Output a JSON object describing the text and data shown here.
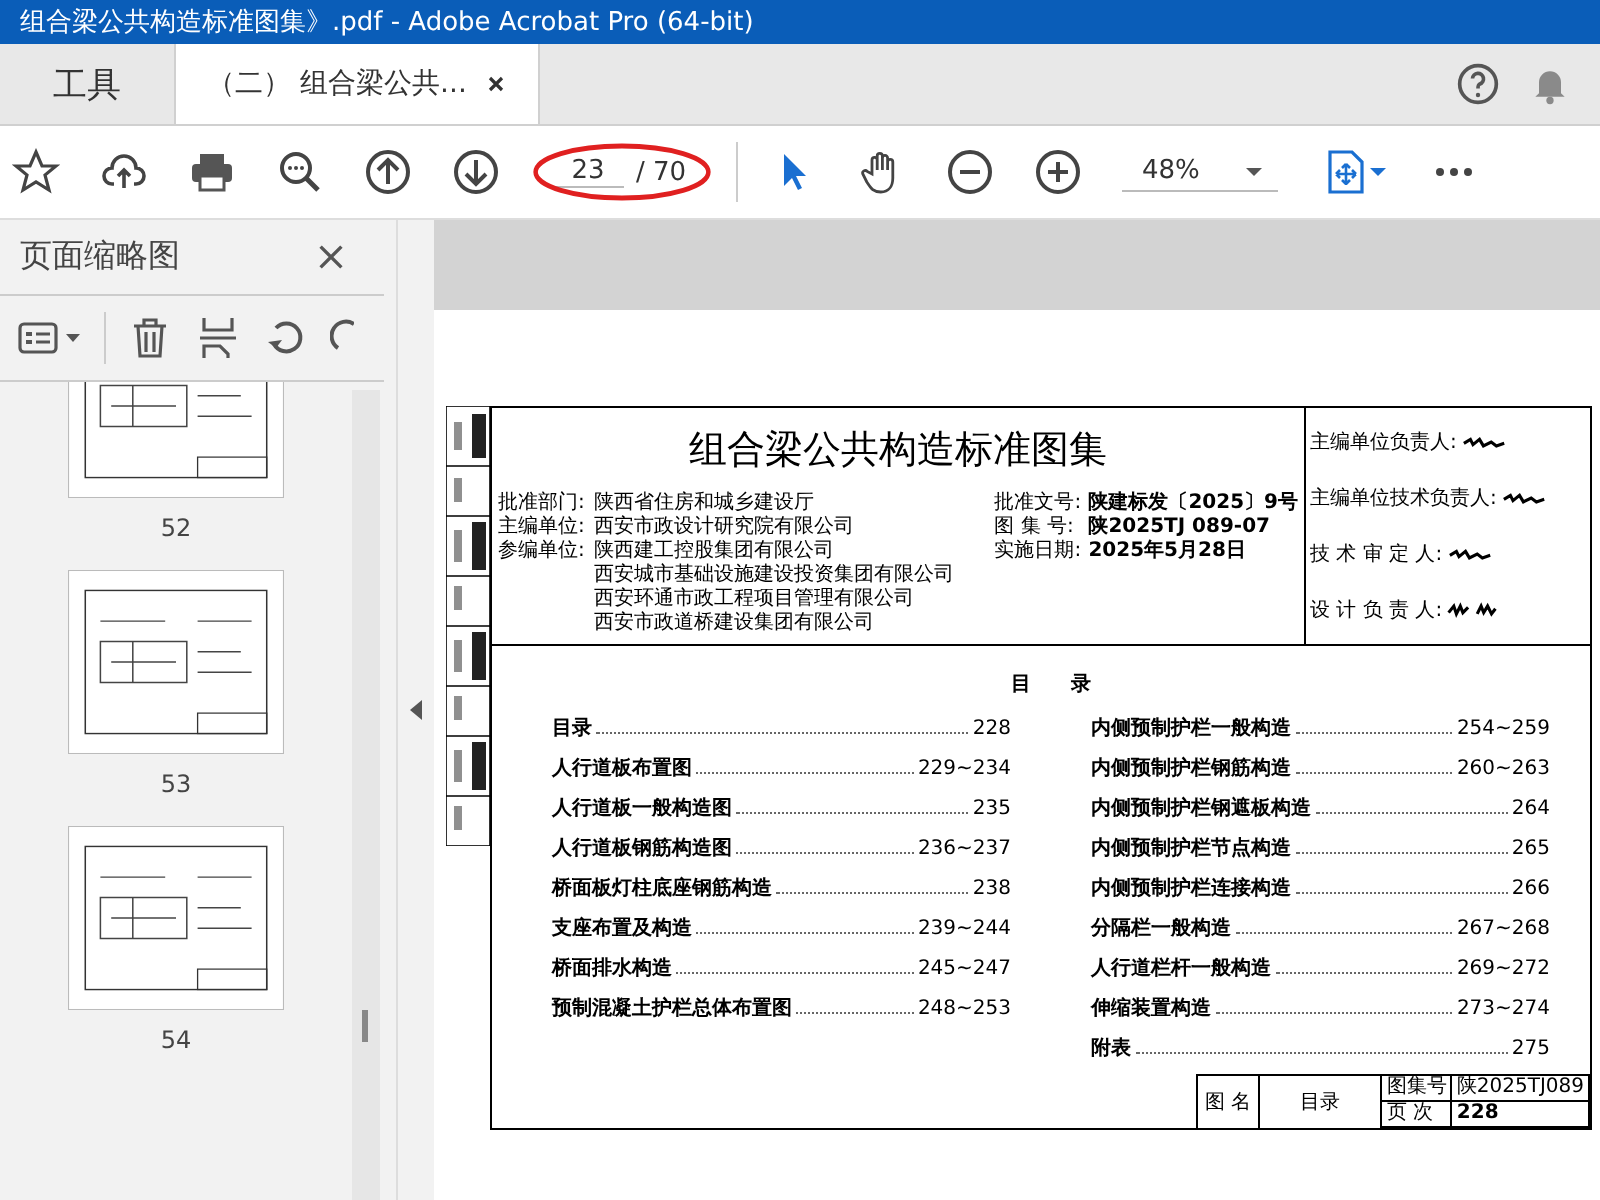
{
  "window": {
    "title": "组合梁公共构造标准图集》.pdf - Adobe Acrobat Pro (64-bit)"
  },
  "tabs": [
    {
      "label": "工具",
      "selected": false
    },
    {
      "label": "（二） 组合梁公共...",
      "selected": true
    }
  ],
  "toolbar": {
    "page_current": "23",
    "page_total": "/ 70",
    "zoom": "48%"
  },
  "sidebar": {
    "title": "页面缩略图",
    "thumbnails": [
      {
        "label": "52"
      },
      {
        "label": "53"
      },
      {
        "label": "54"
      }
    ]
  },
  "document": {
    "title": "组合梁公共构造标准图集",
    "info_left": [
      {
        "label": "批准部门:",
        "value": "陕西省住房和城乡建设厅"
      },
      {
        "label": "主编单位:",
        "value": "西安市政设计研究院有限公司"
      },
      {
        "label": "参编单位:",
        "value": "陕西建工控股集团有限公司"
      },
      {
        "value": "西安城市基础设施建设投资集团有限公司"
      },
      {
        "value": "西安环通市政工程项目管理有限公司"
      },
      {
        "value": "西安市政道桥建设集团有限公司"
      }
    ],
    "info_right": [
      {
        "label": "批准文号:",
        "value": "陕建标发〔2025〕9号"
      },
      {
        "label": "图 集 号:",
        "value": "陕2025TJ 089-07"
      },
      {
        "label": "实施日期:",
        "value": "2025年5月28日"
      }
    ],
    "signers": [
      "主编单位负责人:",
      "主编单位技术负责人:",
      "技 术 审 定 人:",
      "设 计 负 责 人:"
    ],
    "toc_heading": "目　　录",
    "toc_left": [
      {
        "name": "目录",
        "pages": "228"
      },
      {
        "name": "人行道板布置图",
        "pages": "229~234"
      },
      {
        "name": "人行道板一般构造图",
        "pages": "235"
      },
      {
        "name": "人行道板钢筋构造图",
        "pages": "236~237"
      },
      {
        "name": "桥面板灯柱底座钢筋构造",
        "pages": "238"
      },
      {
        "name": "支座布置及构造",
        "pages": "239~244"
      },
      {
        "name": "桥面排水构造",
        "pages": "245~247"
      },
      {
        "name": "预制混凝土护栏总体布置图",
        "pages": "248~253"
      }
    ],
    "toc_right": [
      {
        "name": "内侧预制护栏一般构造",
        "pages": "254~259"
      },
      {
        "name": "内侧预制护栏钢筋构造",
        "pages": "260~263"
      },
      {
        "name": "内侧预制护栏钢遮板构造",
        "pages": "264"
      },
      {
        "name": "内侧预制护栏节点构造",
        "pages": "265"
      },
      {
        "name": "内侧预制护栏连接构造",
        "pages": "266"
      },
      {
        "name": "分隔栏一般构造",
        "pages": "267~268"
      },
      {
        "name": "人行道栏杆一般构造",
        "pages": "269~272"
      },
      {
        "name": "伸缩装置构造",
        "pages": "273~274"
      },
      {
        "name": "附表",
        "pages": "275"
      }
    ],
    "footer": {
      "name_label": "图 名",
      "name": "目录",
      "atlas_label": "图集号",
      "atlas": "陕2025TJ089",
      "page_label": "页 次",
      "page": "228"
    }
  }
}
